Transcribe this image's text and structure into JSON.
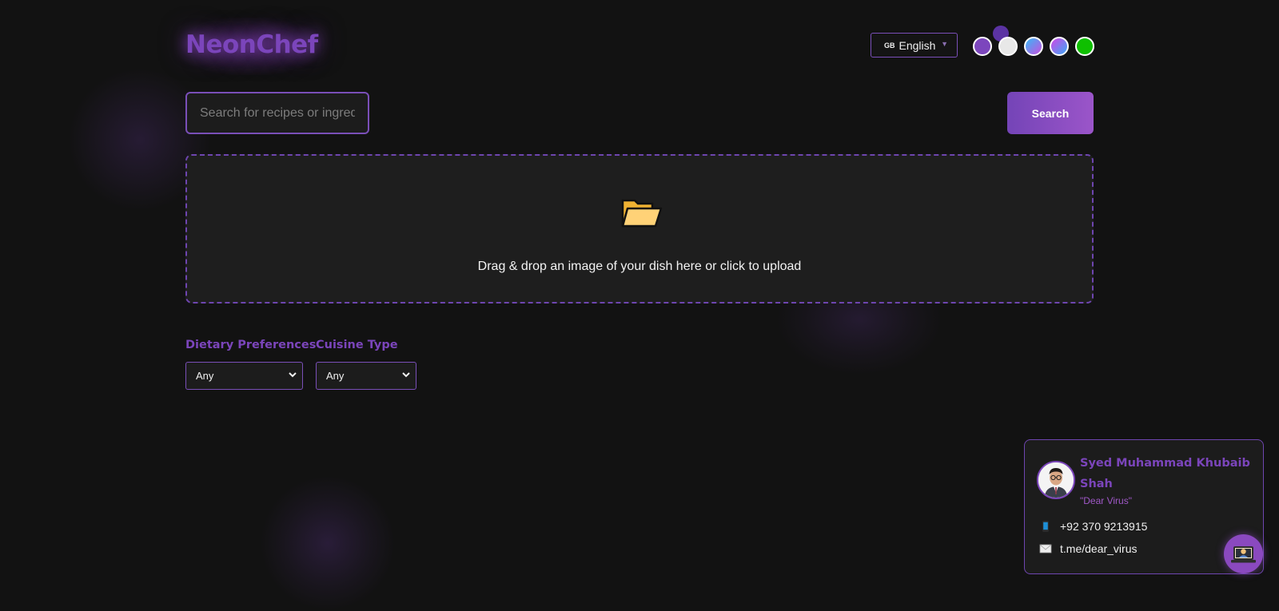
{
  "app": {
    "logo": "NeonChef"
  },
  "header": {
    "language": {
      "flag": "GB",
      "label": "English"
    },
    "theme_swatches": [
      {
        "name": "purple-theme",
        "color": "#7c46bd"
      },
      {
        "name": "light-theme",
        "color": "#e8e8e8"
      },
      {
        "name": "blue-pink-theme",
        "color": "#6b6cf3"
      },
      {
        "name": "pink-blue-theme",
        "color": "#c25be0"
      },
      {
        "name": "green-theme",
        "color": "#0fbf00"
      }
    ]
  },
  "search": {
    "placeholder": "Search for recipes or ingredients",
    "button_label": "Search"
  },
  "upload": {
    "icon": "folder-icon",
    "text": "Drag & drop an image of your dish here or click to upload"
  },
  "filters": {
    "dietary": {
      "label": "Dietary Preferences",
      "value": "Any"
    },
    "cuisine": {
      "label": "Cuisine Type",
      "value": "Any"
    }
  },
  "contact": {
    "name": "Syed Muhammad Khubaib Shah",
    "nickname": "\"Dear Virus\"",
    "phone": "+92 370 9213915",
    "telegram": "t.me/dear_virus"
  },
  "colors": {
    "accent": "#7b45bb",
    "background": "#121212",
    "panel": "#1e1e1e"
  }
}
